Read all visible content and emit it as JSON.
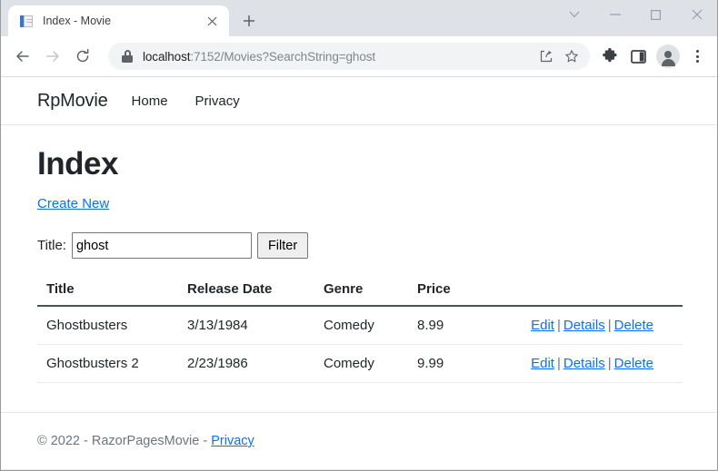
{
  "browser": {
    "tab": {
      "title": "Index - Movie",
      "favicon_icon": "document-page-icon",
      "close_icon": "close-icon"
    },
    "new_tab_icon": "plus-icon",
    "window_controls": [
      {
        "name": "tab-search",
        "icon": "chevron-down-icon",
        "glyph": "⌄"
      },
      {
        "name": "minimize",
        "icon": "minimize-icon",
        "glyph": "—"
      },
      {
        "name": "maximize",
        "icon": "maximize-icon",
        "glyph": "□"
      },
      {
        "name": "close",
        "icon": "close-icon",
        "glyph": "✕"
      }
    ],
    "nav": {
      "back_icon": "arrow-left-icon",
      "forward_icon": "arrow-right-icon",
      "reload_icon": "reload-icon"
    },
    "omnibox": {
      "security_icon": "lock-icon",
      "url_host": "localhost",
      "url_rest": ":7152/Movies?SearchString=ghost",
      "share_icon": "share-icon",
      "bookmark_icon": "star-icon"
    },
    "toolbar": {
      "extensions_icon": "puzzle-piece-icon",
      "side_panel_icon": "side-panel-icon",
      "profile_icon": "avatar-icon",
      "menu_icon": "three-dot-menu-icon"
    }
  },
  "site": {
    "brand": "RpMovie",
    "nav_links": [
      {
        "label": "Home"
      },
      {
        "label": "Privacy"
      }
    ]
  },
  "page": {
    "title": "Index",
    "create_new_label": "Create New",
    "filter": {
      "label": "Title:",
      "value": "ghost",
      "placeholder": "",
      "button_label": "Filter"
    },
    "table": {
      "columns": [
        "Title",
        "Release Date",
        "Genre",
        "Price",
        ""
      ],
      "rows": [
        {
          "title": "Ghostbusters",
          "release_date": "3/13/1984",
          "genre": "Comedy",
          "price": "8.99",
          "actions": [
            "Edit",
            "Details",
            "Delete"
          ]
        },
        {
          "title": "Ghostbusters 2",
          "release_date": "2/23/1986",
          "genre": "Comedy",
          "price": "9.99",
          "actions": [
            "Edit",
            "Details",
            "Delete"
          ]
        }
      ],
      "action_separator": "|"
    }
  },
  "footer": {
    "copyright": "© 2022 - RazorPagesMovie - ",
    "privacy_label": "Privacy"
  },
  "colors": {
    "link": "#0d6efd",
    "tabstrip": "#dee1e6",
    "text": "#212529",
    "muted": "#6c757d"
  }
}
